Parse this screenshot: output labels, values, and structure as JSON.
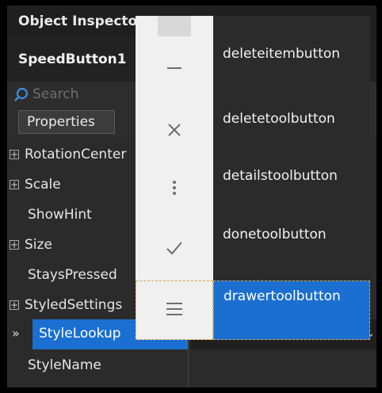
{
  "panel": {
    "title": "Object Inspector",
    "component": "SpeedButton1",
    "search_placeholder": "Search",
    "tab_label": "Properties"
  },
  "properties": [
    {
      "name": "RotationCenter",
      "expandable": true
    },
    {
      "name": "Scale",
      "expandable": true
    },
    {
      "name": "ShowHint",
      "expandable": false
    },
    {
      "name": "Size",
      "expandable": true
    },
    {
      "name": "StaysPressed",
      "expandable": false
    },
    {
      "name": "StyledSettings",
      "expandable": true
    }
  ],
  "selected_property": {
    "marker": "»",
    "name": "StyleLookup",
    "value": "drawertoolbutton"
  },
  "after_property": "StyleName",
  "dropdown": {
    "items": [
      {
        "icon": "blank-icon",
        "label": ""
      },
      {
        "icon": "minus-icon",
        "label": "deleteitembutton"
      },
      {
        "icon": "close-icon",
        "label": "deletetoolbutton"
      },
      {
        "icon": "more-vertical-icon",
        "label": "detailstoolbutton"
      },
      {
        "icon": "checkmark-icon",
        "label": "donetoolbutton"
      },
      {
        "icon": "hamburger-menu-icon",
        "label": "drawertoolbutton"
      }
    ],
    "selected_label": "drawertoolbutton"
  },
  "colors": {
    "selection": "#1a6fd1",
    "panel_bg": "#2b2b2b",
    "popup_icon_bg": "#f0f0f0",
    "focus_outline": "#d9a441"
  }
}
